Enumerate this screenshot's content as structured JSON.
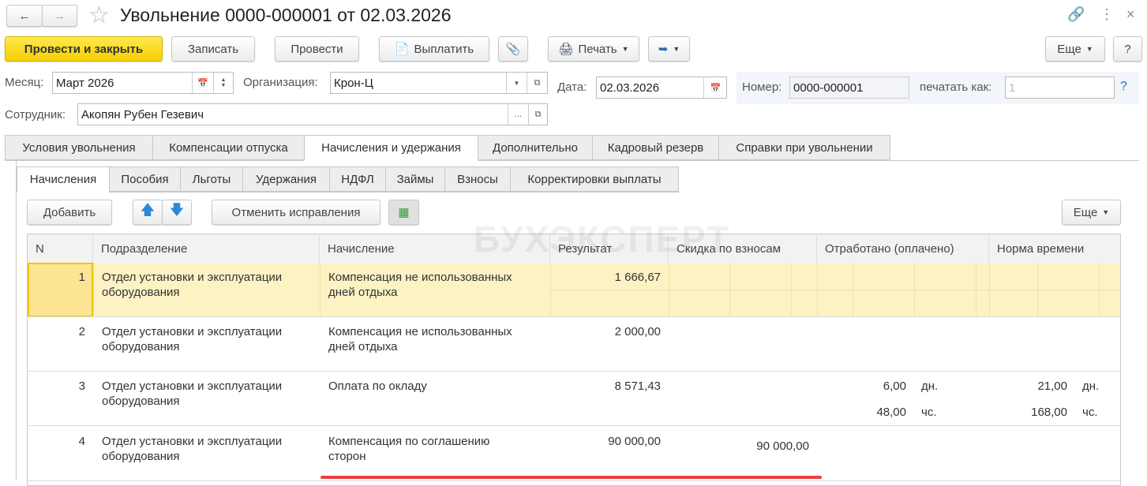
{
  "title": "Увольнение 0000-000001 от 02.03.2026",
  "toolbar": {
    "post_close": "Провести и закрыть",
    "save": "Записать",
    "post": "Провести",
    "pay": "Выплатить",
    "print": "Печать",
    "more": "Еще",
    "help": "?"
  },
  "header": {
    "month_label": "Месяц:",
    "month": "Март 2026",
    "org_label": "Организация:",
    "org": "Крон-Ц",
    "date_label": "Дата:",
    "date": "02.03.2026",
    "number_label": "Номер:",
    "number": "0000-000001",
    "print_as_label": "печатать как:",
    "print_as": "1",
    "help": "?",
    "employee_label": "Сотрудник:",
    "employee": "Акопян Рубен Гезевич",
    "ellipsis": "..."
  },
  "tabs": [
    "Условия увольнения",
    "Компенсации отпуска",
    "Начисления и удержания",
    "Дополнительно",
    "Кадровый резерв",
    "Справки при увольнении"
  ],
  "subtabs": [
    "Начисления",
    "Пособия",
    "Льготы",
    "Удержания",
    "НДФЛ",
    "Займы",
    "Взносы",
    "Корректировки выплаты"
  ],
  "table_toolbar": {
    "add": "Добавить",
    "cancel_fix": "Отменить исправления",
    "more": "Еще"
  },
  "watermark": "БУХЭКСПЕРТ",
  "columns": [
    "N",
    "Подразделение",
    "Начисление",
    "Результат",
    "Скидка по взносам",
    "Отработано (оплачено)",
    "Норма времени"
  ],
  "rows": [
    {
      "n": "1",
      "dept1": "Отдел установки и эксплуатации",
      "dept2": "оборудования",
      "acc1": "Компенсация не использованных",
      "acc2": "дней отдыха",
      "result": "1 666,67",
      "discount": "",
      "w1": "",
      "w1u": "",
      "w2": "",
      "w2u": "",
      "n1": "",
      "n1u": "",
      "n2": "",
      "n2u": ""
    },
    {
      "n": "2",
      "dept1": "Отдел установки и эксплуатации",
      "dept2": "оборудования",
      "acc1": "Компенсация не использованных",
      "acc2": "дней отдыха",
      "result": "2 000,00",
      "discount": "",
      "w1": "",
      "w1u": "",
      "w2": "",
      "w2u": "",
      "n1": "",
      "n1u": "",
      "n2": "",
      "n2u": ""
    },
    {
      "n": "3",
      "dept1": "Отдел установки и эксплуатации",
      "dept2": "оборудования",
      "acc1": "Оплата по окладу",
      "acc2": "",
      "result": "8 571,43",
      "discount": "",
      "w1": "6,00",
      "w1u": "дн.",
      "w2": "48,00",
      "w2u": "чс.",
      "n1": "21,00",
      "n1u": "дн.",
      "n2": "168,00",
      "n2u": "чс."
    },
    {
      "n": "4",
      "dept1": "Отдел установки и эксплуатации",
      "dept2": "оборудования",
      "acc1": "Компенсация по соглашению",
      "acc2": "сторон",
      "result": "90 000,00",
      "discount": "90 000,00",
      "w1": "",
      "w1u": "",
      "w2": "",
      "w2u": "",
      "n1": "",
      "n1u": "",
      "n2": "",
      "n2u": ""
    }
  ]
}
